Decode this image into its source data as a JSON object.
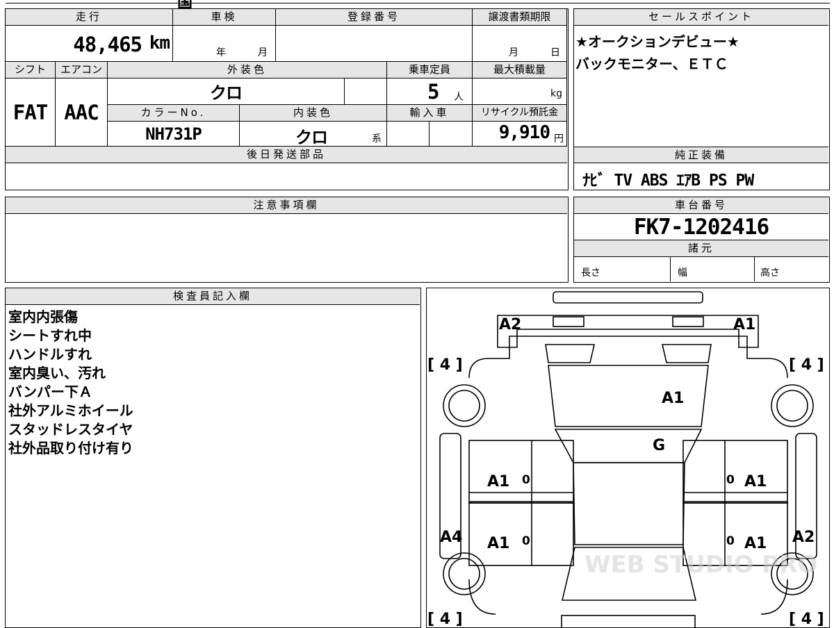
{
  "top_strip": {
    "partial": "国"
  },
  "mileage": {
    "label": "走行",
    "value": "48,465",
    "unit": "km"
  },
  "inspection": {
    "label": "車検",
    "year": "年",
    "month": "月"
  },
  "registration": {
    "label": "登録番号",
    "value": ""
  },
  "transfer_deadline": {
    "label": "譲渡書類期限",
    "month": "月",
    "day": "日"
  },
  "shift": {
    "label": "シフト",
    "value": "FAT"
  },
  "aircon": {
    "label": "エアコン",
    "value": "AAC"
  },
  "exterior_color": {
    "label": "外装色",
    "value": "クロ"
  },
  "capacity": {
    "label": "乗車定員",
    "value": "5",
    "unit": "人"
  },
  "max_load": {
    "label": "最大積載量",
    "value": "",
    "unit": "kg"
  },
  "color_no": {
    "label": "カラーNo.",
    "value": "NH731P"
  },
  "interior_color": {
    "label": "内装色",
    "value": "クロ",
    "suffix": "系"
  },
  "imported": {
    "label": "輸入車",
    "value": ""
  },
  "recycle_fee": {
    "label": "リサイクル預託金",
    "value": "9,910",
    "unit": "円"
  },
  "later_shipping": {
    "label": "後日発送部品",
    "value": ""
  },
  "sales_point": {
    "label": "セールスポイント",
    "lines": [
      "★オークションデビュー★",
      "バックモニター、ＥＴＣ"
    ]
  },
  "genuine_equipment": {
    "label": "純正装備",
    "value": "ﾅﾋﾞ TV ABS ｴｱB PS PW"
  },
  "notes": {
    "label": "注意事項欄",
    "value": ""
  },
  "chassis": {
    "label": "車台番号",
    "value": "FK7-1202416"
  },
  "specs": {
    "label": "諸元",
    "length": "長さ",
    "width": "幅",
    "height": "高さ"
  },
  "inspector": {
    "label": "検査員記入欄",
    "lines": [
      "室内内張傷",
      "シートすれ中",
      "ハンドルすれ",
      "室内臭い、汚れ",
      "バンパー下Ａ",
      "社外アルミホイール",
      "スタッドレスタイヤ",
      "社外品取り付け有り"
    ]
  },
  "diagram": {
    "front_left": "A2",
    "front_right": "A1",
    "tire_fl": "[ 4 ]",
    "tire_fr": "[ 4 ]",
    "tire_rl": "[ 4 ]",
    "tire_rr": "[ 4 ]",
    "hood": "A1",
    "windshield": "G",
    "door_fl": "A1",
    "door_fr": "A1",
    "door_rl": "A1",
    "door_rr": "A1",
    "zero": "0",
    "side_left": "A4",
    "side_right": "A2",
    "watermark": "WEB STUDIO PRO"
  }
}
